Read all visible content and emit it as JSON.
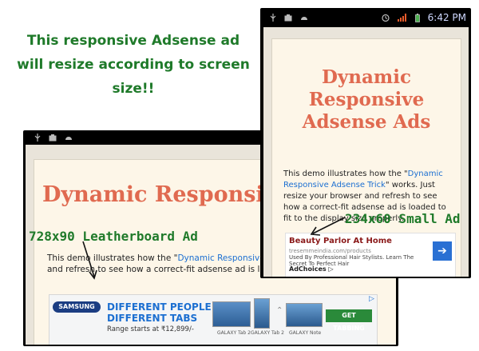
{
  "caption": {
    "line1": "This responsive Adsense ad",
    "line2": "will resize according to screen",
    "line3": "size!!"
  },
  "landscape": {
    "title": "Dynamic Responsive T",
    "text_before_link": "This demo illustrates how the \"",
    "link_text": "Dynamic Responsive Adsense",
    "text_after_link": " browser and refresh to see how a correct-fit adsense ad is loa properly.",
    "banner": {
      "brand": "SAMSUNG",
      "headline1": "DIFFERENT PEOPLE",
      "headline2": "DIFFERENT TABS",
      "price": "Range starts at ₹12,899/-",
      "caption_a": "GALAXY Tab 2",
      "caption_b": "GALAXY Tab 2",
      "caption_c": "GALAXY Note",
      "cta": "GET TABBING",
      "adchoices_icon": "▷"
    }
  },
  "portrait": {
    "time": "6:42 PM",
    "title_line1": "Dynamic",
    "title_line2": "Responsive",
    "title_line3": "Adsense Ads",
    "text_before_link": "This demo illustrates how the \"",
    "link_text": "Dynamic Responsive Adsense Trick",
    "text_after_link": "\" works. Just resize your browser and refresh to see how a correct-fit adsense ad is loaded to fit to the display size properly.",
    "small_ad": {
      "title": "Beauty Parlor At Home",
      "url": "tresemmeindia.com/products",
      "desc": "Used By Professional Hair Stylists. Learn The Secret To Perfect Hair",
      "adchoices": "AdChoices ▷",
      "button": "➔"
    }
  },
  "annotations": {
    "leaderboard": "728x90 Leatherboard Ad",
    "small": "234x60 Small Ad"
  },
  "colors": {
    "caption_green": "#1f7a2a",
    "title_orange": "#e06a50",
    "link_blue": "#1c6fd1"
  }
}
